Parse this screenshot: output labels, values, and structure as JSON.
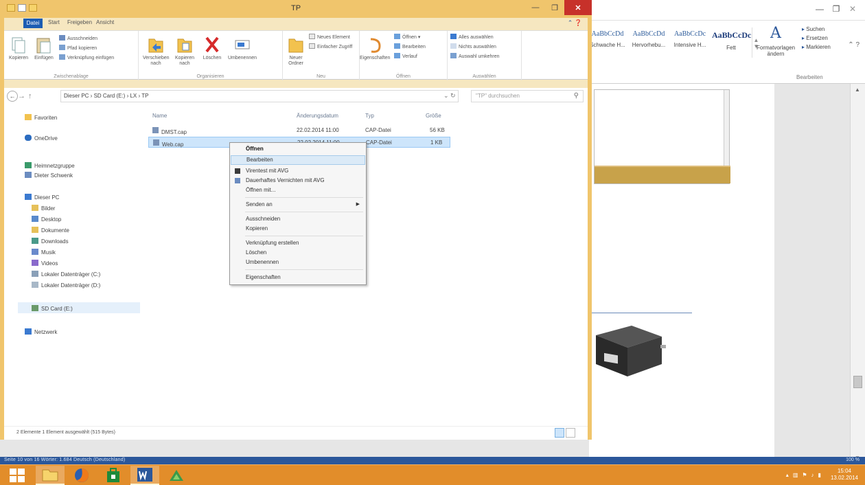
{
  "explorer": {
    "title": "TP",
    "tabs": {
      "file": "Datei",
      "start": "Start",
      "share": "Freigeben",
      "view": "Ansicht"
    },
    "ribbon": {
      "clipboard": {
        "label": "Zwischenablage",
        "copy": "Kopieren",
        "paste": "Einfügen",
        "cut": "Ausschneiden",
        "copy_path": "Pfad kopieren",
        "paste_shortcut": "Verknüpfung einfügen"
      },
      "organize": {
        "label": "Organisieren",
        "move_to": "Verschieben nach",
        "copy_to": "Kopieren nach",
        "delete": "Löschen",
        "rename": "Umbenennen"
      },
      "new": {
        "label": "Neu",
        "new_folder": "Neuer Ordner",
        "new_item": "Neues Element",
        "easy_access": "Einfacher Zugriff"
      },
      "open": {
        "label": "Öffnen",
        "properties": "Eigenschaften",
        "open": "Öffnen",
        "edit": "Bearbeiten",
        "history": "Verlauf"
      },
      "select": {
        "label": "Auswählen",
        "select_all": "Alles auswählen",
        "select_none": "Nichts auswählen",
        "invert": "Auswahl umkehren"
      }
    },
    "address": "Dieser PC  ›  SD Card (E:)  ›  LX  ›  TP",
    "search_placeholder": "\"TP\" durchsuchen",
    "columns": {
      "name": "Name",
      "date": "Änderungsdatum",
      "type": "Typ",
      "size": "Größe"
    },
    "files": [
      {
        "name": "DMST.cap",
        "date": "22.02.2014 11:00",
        "type": "CAP-Datei",
        "size": "56 KB"
      },
      {
        "name": "Web.cap",
        "date": "22.02.2014 11:00",
        "type": "CAP-Datei",
        "size": "1 KB"
      }
    ],
    "tree": {
      "favorites": "Favoriten",
      "onedrive": "OneDrive",
      "homegroup": "Heimnetzgruppe",
      "user": "Dieter Schwenk",
      "this_pc": "Dieser PC",
      "pictures": "Bilder",
      "desktop": "Desktop",
      "documents": "Dokumente",
      "downloads": "Downloads",
      "music": "Musik",
      "videos": "Videos",
      "drive_c": "Lokaler Datenträger (C:)",
      "drive_d": "Lokaler Datenträger (D:)",
      "sd_card": "SD Card (E:)",
      "network": "Netzwerk"
    },
    "status": "2 Elemente    1 Element ausgewählt (515 Bytes)"
  },
  "context_menu": {
    "open": "Öffnen",
    "edit": "Bearbeiten",
    "scan_avg": "Virentest mit AVG",
    "shred_avg": "Dauerhaftes Vernichten mit AVG",
    "open_with": "Öffnen mit...",
    "send_to": "Senden an",
    "cut": "Ausschneiden",
    "copy": "Kopieren",
    "create_shortcut": "Verknüpfung erstellen",
    "delete": "Löschen",
    "rename": "Umbenennen",
    "properties": "Eigenschaften"
  },
  "word": {
    "styles": [
      {
        "sample": "AaBbCcDd",
        "name": "Schwache H..."
      },
      {
        "sample": "AaBbCcDd",
        "name": "Hervorhebu..."
      },
      {
        "sample": "AaBbCcDc",
        "name": "Intensive H..."
      },
      {
        "sample": "AaBbCcDc",
        "name": "Fett"
      }
    ],
    "format_templates": "Formatvorlagen ändern",
    "edit_group": {
      "find": "Suchen",
      "replace": "Ersetzen",
      "select": "Markieren",
      "label": "Bearbeiten"
    },
    "status_left": "Seite 10 von 16    Wörter: 1.684    Deutsch (Deutschland)",
    "status_zoom": "100 %"
  },
  "taskbar": {
    "time": "15:04",
    "date": "13.02.2014"
  },
  "colors": {
    "explorer_frame": "#f0c56c",
    "taskbar": "#e28d2a",
    "close_button": "#c7312a",
    "word_blue": "#2b579a"
  }
}
